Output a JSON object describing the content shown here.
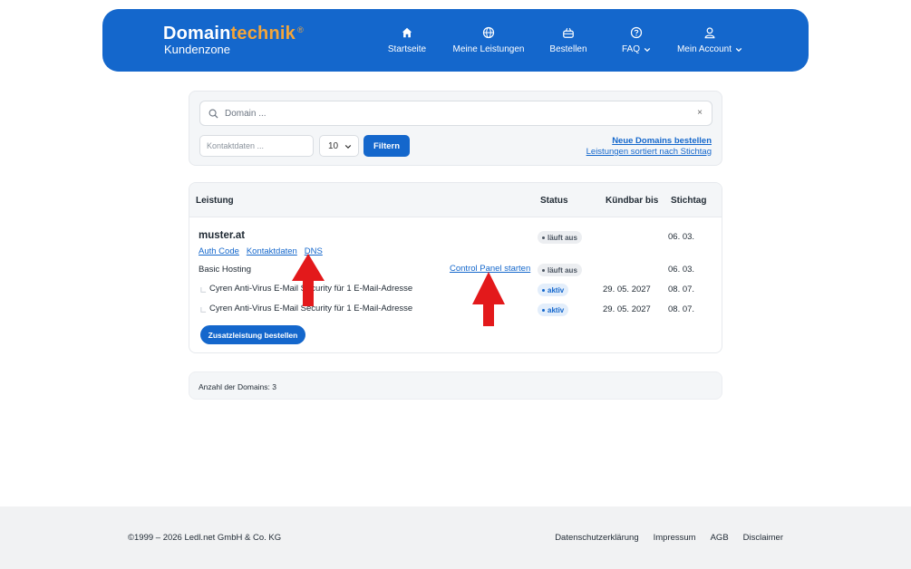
{
  "brand": {
    "name_part1": "Domain",
    "name_part2": "technik",
    "registered": "®",
    "subtitle": "Kundenzone"
  },
  "nav": [
    {
      "label": "Startseite",
      "icon": "home-icon"
    },
    {
      "label": "Meine Leistungen",
      "icon": "globe-icon"
    },
    {
      "label": "Bestellen",
      "icon": "basket-icon"
    },
    {
      "label": "FAQ",
      "icon": "help-circle-icon"
    },
    {
      "label": "Mein Account",
      "icon": "user-icon"
    }
  ],
  "filter": {
    "search_placeholder": "Domain ...",
    "clear_symbol": "×",
    "contact_placeholder": "Kontaktdaten ...",
    "per_page": "10",
    "filter_button": "Filtern",
    "link_new_domains": "Neue Domains bestellen",
    "link_sorted": "Leistungen sortiert nach Stichtag"
  },
  "table": {
    "headers": {
      "service": "Leistung",
      "status": "Status",
      "cancel_until": "Kündbar bis",
      "due_date": "Stichtag"
    },
    "domain": {
      "name": "muster.at",
      "links": [
        "Auth Code",
        "Kontaktdaten",
        "DNS"
      ],
      "status": "läuft aus",
      "due_date": "06. 03."
    },
    "rows": [
      {
        "name": "Basic Hosting",
        "action": "Control Panel starten",
        "status": "läuft aus",
        "status_type": "expiring",
        "cancel_until": "",
        "due_date": "06. 03."
      },
      {
        "name": "Cyren Anti-Virus E-Mail Security für 1 E-Mail-Adresse",
        "action": "",
        "status": "aktiv",
        "status_type": "active",
        "cancel_until": "29. 05. 2027",
        "due_date": "08. 07."
      },
      {
        "name": "Cyren Anti-Virus E-Mail Security für 1 E-Mail-Adresse",
        "action": "",
        "status": "aktiv",
        "status_type": "active",
        "cancel_until": "29. 05. 2027",
        "due_date": "08. 07."
      }
    ],
    "add_button": "Zusatzleistung bestellen"
  },
  "count": {
    "text": "Anzahl der Domains: 3"
  },
  "footer": {
    "copyright": "©1999 – 2026 Ledl.net GmbH & Co. KG",
    "links": [
      "Datenschutzerklärung",
      "Impressum",
      "AGB",
      "Disclaimer"
    ]
  },
  "colors": {
    "primary": "#1467cc",
    "accent": "#f3a53a",
    "annotation_arrow": "#e3191b"
  }
}
